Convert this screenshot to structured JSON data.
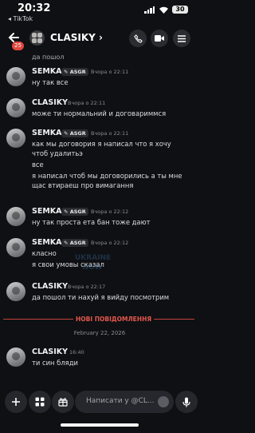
{
  "status_bar": {
    "time": "20:32",
    "back_app": "◂ TikTok",
    "battery": "30"
  },
  "header": {
    "channel": "CLASIKY",
    "chevron": "›",
    "unread_count": "25"
  },
  "messages": {
    "cut_top": "да пошол",
    "m1": {
      "author": "SEMKA",
      "tag": "ASGR",
      "time": "Вчора о 22:11",
      "lines": [
        "ну так все"
      ]
    },
    "m2": {
      "author": "CLASIKY",
      "time": "Вчора о 22:11",
      "lines": [
        "може ти нормальний и договариммся"
      ]
    },
    "m3": {
      "author": "SEMKA",
      "tag": "ASGR",
      "time": "Вчора о 22:11",
      "lines": [
        "как мы договория я написал что я хочу",
        "чтоб удалитьэ",
        "все",
        "я написал чтоб мы договорились а ты мне",
        "щас втираеш про вимагання"
      ]
    },
    "m4": {
      "author": "SEMKA",
      "tag": "ASGR",
      "time": "Вчора о 22:12",
      "lines": [
        "ну так проста ета бан тоже дают"
      ]
    },
    "m5": {
      "author": "SEMKA",
      "tag": "ASGR",
      "time": "Вчора о 22:12",
      "lines": [
        "класно",
        "я свои умовы сказал"
      ]
    },
    "m6": {
      "author": "CLASIKY",
      "time": "Вчора о 22:17",
      "lines": [
        "да пошол ти нахуй я вийду посмотрим"
      ]
    },
    "new_label": "НОВІ ПОВІДОМЛЕННЯ",
    "date_label": "February 22, 2026",
    "m7": {
      "author": "CLASIKY",
      "time": "16:40",
      "lines": [
        "ти син бляди"
      ]
    }
  },
  "watermark": [
    "UKRAINE",
    "NOW"
  ],
  "composer": {
    "placeholder": "Написати у @CL..."
  },
  "colors": {
    "background": "#0f1013",
    "new_divider": "#e4574d",
    "badge": "#e0463e"
  },
  "icons": [
    "back-arrow-icon",
    "server-avatar-icon",
    "call-icon",
    "video-icon",
    "menu-icon",
    "plus-icon",
    "apps-icon",
    "gift-icon",
    "emoji-icon",
    "mic-icon"
  ]
}
